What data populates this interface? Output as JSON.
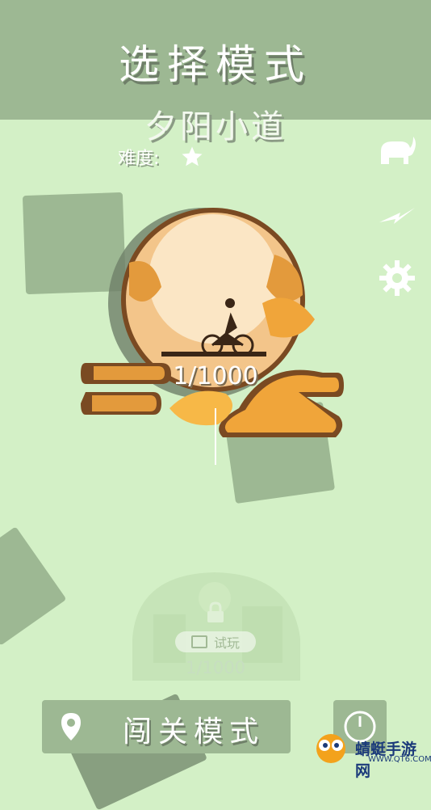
{
  "header": {
    "title": "选择模式"
  },
  "level": {
    "name": "夕阳小道",
    "difficulty_label": "难度:",
    "difficulty_stars": 1,
    "progress_text": "1/1000"
  },
  "sidebar": {
    "icons": [
      "elephant-icon",
      "lightning-icon",
      "gear-icon"
    ]
  },
  "locked_level": {
    "trial_label": "试玩",
    "progress_text": "1/1000"
  },
  "bottom": {
    "mode_label": "闯关模式",
    "mode_icon": "location-pin-icon",
    "clock_icon": "clock-icon"
  },
  "watermark": {
    "brand": "蜻蜓手游网",
    "url": "WWW.QT6.COM"
  },
  "colors": {
    "background": "#d3f0c6",
    "accent": "#9db893"
  }
}
